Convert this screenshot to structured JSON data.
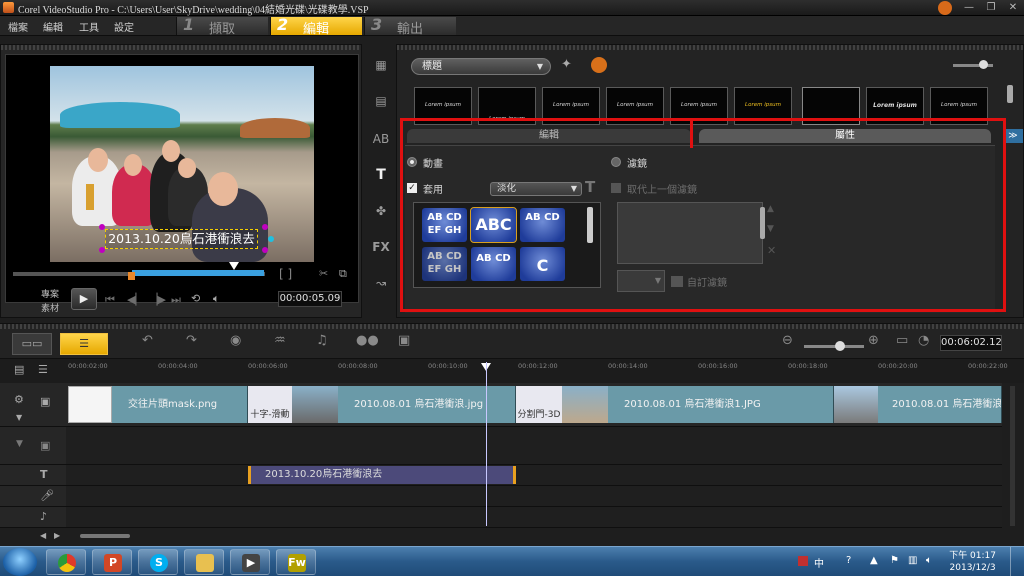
{
  "window": {
    "title": "Corel VideoStudio Pro - C:\\Users\\User\\SkyDrive\\wedding\\04結婚光碟\\光碟教學.VSP",
    "controls": [
      "minimize-icon",
      "restore-icon",
      "close-icon"
    ]
  },
  "menu": {
    "items": [
      "檔案",
      "編輯",
      "工具",
      "設定"
    ]
  },
  "steps": [
    {
      "num": "1",
      "label": "擷取",
      "active": false
    },
    {
      "num": "2",
      "label": "編輯",
      "active": true
    },
    {
      "num": "3",
      "label": "輸出",
      "active": false
    }
  ],
  "preview": {
    "caption": "2013.10.20烏石港衝浪去",
    "mode_project": "專案",
    "mode_clip": "素材",
    "timecode": "00:00:05.09",
    "mark_brackets": "[  ]"
  },
  "library": {
    "category": "標題",
    "thumbnails": [
      "Lorem ipsum",
      "Lorem ipsum",
      "Lorem ipsum",
      "Lorem ipsum",
      "Lorem ipsum",
      "Lorem ipsum",
      "",
      "Lorem ipsum",
      "Lorem ipsum"
    ],
    "tabs": {
      "edit": "編輯",
      "properties": "屬性"
    }
  },
  "properties": {
    "animation_label": "動畫",
    "filter_label": "濾鏡",
    "apply_label": "套用",
    "animation_type": "淡化",
    "replace_filter_label": "取代上一個濾鏡",
    "custom_filter_label": "自訂濾鏡",
    "presets": [
      "AB CD EF GH",
      "ABC",
      "AB CD",
      "AB CD EF GH",
      "AB CD",
      "C"
    ]
  },
  "timeline": {
    "timecode": "00:06:02.12",
    "ruler_ticks": [
      "00:00:02:00",
      "00:00:04:00",
      "00:00:06:00",
      "00:00:08:00",
      "00:00:10:00",
      "00:00:12:00",
      "00:00:14:00",
      "00:00:16:00",
      "00:00:18:00",
      "00:00:20:00",
      "00:00:22:00"
    ],
    "video_clips": [
      "交往片頭mask.png",
      "2010.08.01 烏石港衝浪.jpg",
      "2010.08.01 烏石港衝浪1.JPG",
      "2010.08.01 烏石港衝浪"
    ],
    "transitions": [
      "十字-滑動",
      "分割門-3D"
    ],
    "title_clip": "2013.10.20烏石港衝浪去"
  },
  "taskbar": {
    "apps": [
      "chrome",
      "powerpoint",
      "skype",
      "explorer",
      "videostudio",
      "fireworks"
    ],
    "time": "下午 01:17",
    "date": "2013/12/3",
    "ime": "中"
  }
}
